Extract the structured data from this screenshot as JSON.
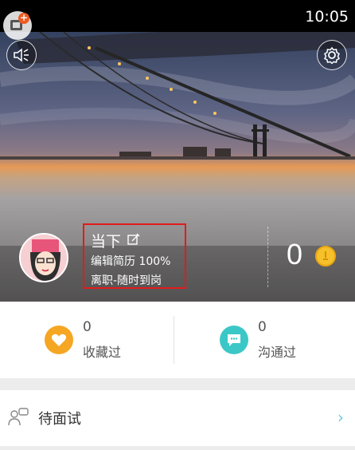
{
  "status_bar": {
    "time": "10:05"
  },
  "header": {
    "sound_icon": "speaker-icon",
    "settings_icon": "gear-icon"
  },
  "profile": {
    "name": "当下",
    "edit_icon": "edit-icon",
    "resume": "编辑简历 100%",
    "job_status": "离职-随时到岗",
    "coins": "0",
    "coin_icon": "coin-icon"
  },
  "stats": [
    {
      "count": "0",
      "label": "收藏过",
      "icon": "heart-icon",
      "color": "#f5a623"
    },
    {
      "count": "0",
      "label": "沟通过",
      "icon": "chat-icon",
      "color": "#3cc7c7"
    }
  ],
  "menu": {
    "items": [
      {
        "label": "待面试",
        "icon": "interview-icon",
        "chevron": "›"
      }
    ]
  },
  "colors": {
    "highlight": "#e21b1b",
    "accent": "#6cc7d9"
  }
}
